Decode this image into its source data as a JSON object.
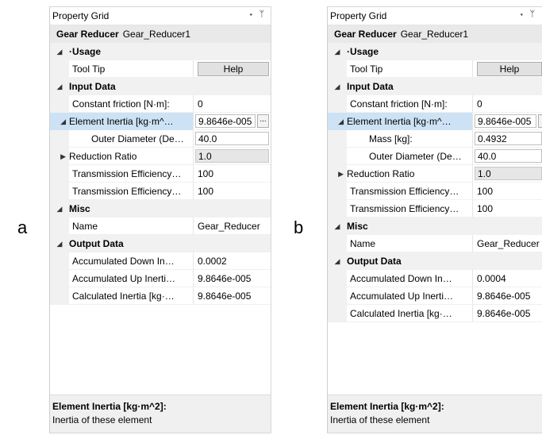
{
  "labels": {
    "a": "a",
    "b": "b"
  },
  "icons": {
    "dropdown": "chevron-down-icon",
    "pin": "pin-icon",
    "expanded": "triangle-down-icon",
    "collapsed": "triangle-right-icon"
  },
  "colors": {
    "selected_row": "#cde3f5",
    "category_bg": "#f1f1f1",
    "header_bg": "#e9e9e9"
  },
  "panel_a": {
    "title": "Property Grid",
    "object_type": "Gear Reducer",
    "object_name": "Gear_Reducer1",
    "categories": {
      "usage": {
        "label": "·Usage",
        "tooltip_name": "Tool Tip",
        "tooltip_button": "Help"
      },
      "input": {
        "label": "Input Data",
        "constant_friction_name": "Constant friction [N·m]:",
        "constant_friction_value": "0",
        "element_inertia_name": "Element Inertia [kg·m^…",
        "element_inertia_value": "9.8646e-005",
        "outer_diameter_name": "Outer Diameter (De…",
        "outer_diameter_value": "40.0",
        "reduction_ratio_name": "Reduction Ratio",
        "reduction_ratio_value": "1.0",
        "trans_eff_1_name": "Transmission Efficiency…",
        "trans_eff_1_value": "100",
        "trans_eff_2_name": "Transmission Efficiency…",
        "trans_eff_2_value": "100"
      },
      "misc": {
        "label": "Misc",
        "name_name": "Name",
        "name_value": "Gear_Reducer"
      },
      "output": {
        "label": "Output Data",
        "acc_down_name": "Accumulated Down In…",
        "acc_down_value": "0.0002",
        "acc_up_name": "Accumulated Up Inerti…",
        "acc_up_value": "9.8646e-005",
        "calc_name": "Calculated Inertia [kg·…",
        "calc_value": "9.8646e-005"
      }
    },
    "description_title": "Element Inertia [kg·m^2]:",
    "description_text": "Inertia of these element",
    "ellipsis": "..."
  },
  "panel_b": {
    "title": "Property Grid",
    "object_type": "Gear Reducer",
    "object_name": "Gear_Reducer1",
    "categories": {
      "usage": {
        "label": "·Usage",
        "tooltip_name": "Tool Tip",
        "tooltip_button": "Help"
      },
      "input": {
        "label": "Input Data",
        "constant_friction_name": "Constant friction [N·m]:",
        "constant_friction_value": "0",
        "element_inertia_name": "Element Inertia [kg·m^…",
        "element_inertia_value": "9.8646e-005",
        "mass_name": "Mass [kg]:",
        "mass_value": "0.4932",
        "outer_diameter_name": "Outer Diameter (De…",
        "outer_diameter_value": "40.0",
        "reduction_ratio_name": "Reduction Ratio",
        "reduction_ratio_value": "1.0",
        "trans_eff_1_name": "Transmission Efficiency…",
        "trans_eff_1_value": "100",
        "trans_eff_2_name": "Transmission Efficiency…",
        "trans_eff_2_value": "100"
      },
      "misc": {
        "label": "Misc",
        "name_name": "Name",
        "name_value": "Gear_Reducer"
      },
      "output": {
        "label": "Output Data",
        "acc_down_name": "Accumulated Down In…",
        "acc_down_value": "0.0004",
        "acc_up_name": "Accumulated Up Inerti…",
        "acc_up_value": "9.8646e-005",
        "calc_name": "Calculated Inertia [kg·…",
        "calc_value": "9.8646e-005"
      }
    },
    "description_title": "Element Inertia [kg·m^2]:",
    "description_text": "Inertia of these element",
    "ellipsis": "."
  }
}
